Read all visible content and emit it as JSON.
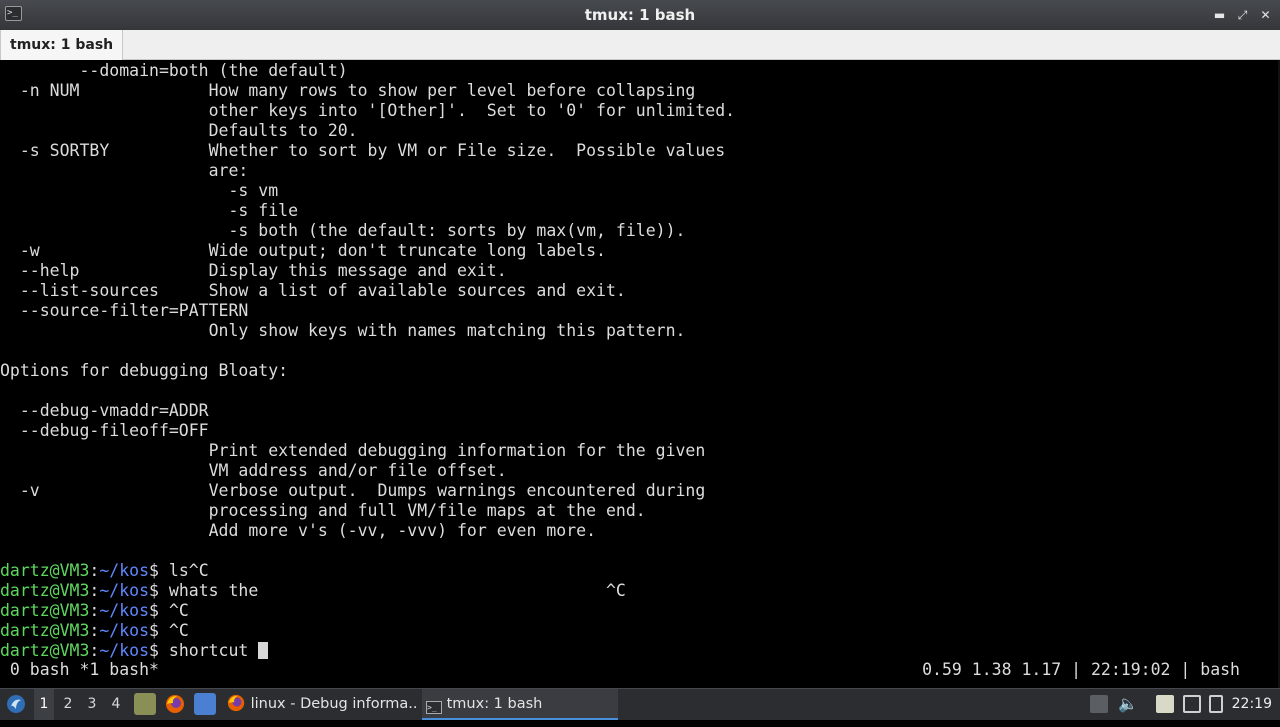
{
  "window": {
    "title": "tmux: 1 bash",
    "tab_label": "tmux: 1 bash",
    "app_icon_glyph": ">_",
    "buttons": {
      "minimize": "▬",
      "maximize": "⤢",
      "close": "✕"
    }
  },
  "terminal": {
    "lines": [
      "        --domain=both (the default)",
      "  -n NUM             How many rows to show per level before collapsing",
      "                     other keys into '[Other]'.  Set to '0' for unlimited.",
      "                     Defaults to 20.",
      "  -s SORTBY          Whether to sort by VM or File size.  Possible values",
      "                     are:",
      "                       -s vm",
      "                       -s file",
      "                       -s both (the default: sorts by max(vm, file)).",
      "  -w                 Wide output; don't truncate long labels.",
      "  --help             Display this message and exit.",
      "  --list-sources     Show a list of available sources and exit.",
      "  --source-filter=PATTERN",
      "                     Only show keys with names matching this pattern.",
      "",
      "Options for debugging Bloaty:",
      "",
      "  --debug-vmaddr=ADDR",
      "  --debug-fileoff=OFF",
      "                     Print extended debugging information for the given",
      "                     VM address and/or file offset.",
      "  -v                 Verbose output.  Dumps warnings encountered during",
      "                     processing and full VM/file maps at the end.",
      "                     Add more v's (-vv, -vvv) for even more.",
      ""
    ],
    "prompts": [
      {
        "user": "dartz@VM3",
        "sep": ":",
        "path": "~/kos",
        "sign": "$ ",
        "cmd": "ls^C"
      },
      {
        "user": "dartz@VM3",
        "sep": ":",
        "path": "~/kos",
        "sign": "$ ",
        "cmd": "whats the                                   ^C"
      },
      {
        "user": "dartz@VM3",
        "sep": ":",
        "path": "~/kos",
        "sign": "$ ",
        "cmd": "^C"
      },
      {
        "user": "dartz@VM3",
        "sep": ":",
        "path": "~/kos",
        "sign": "$ ",
        "cmd": "^C"
      },
      {
        "user": "dartz@VM3",
        "sep": ":",
        "path": "~/kos",
        "sign": "$ ",
        "cmd": "shortcut "
      }
    ],
    "status": {
      "windows": " 0 bash *1 bash*",
      "right": "0.59 1.38 1.17 | 22:19:02 | bash"
    }
  },
  "taskbar": {
    "workspaces": [
      "1",
      "2",
      "3",
      "4"
    ],
    "active_workspace": "1",
    "tasks": [
      {
        "label": "linux - Debug informa...",
        "icon": "firefox-icon",
        "active": false
      },
      {
        "label": "tmux: 1 bash",
        "icon": "terminal-icon",
        "active": true
      }
    ],
    "clock": "22:19",
    "colors": {
      "accent": "#4a8fd9",
      "prompt_user": "#5fd75f",
      "prompt_path": "#5f87ff"
    }
  }
}
